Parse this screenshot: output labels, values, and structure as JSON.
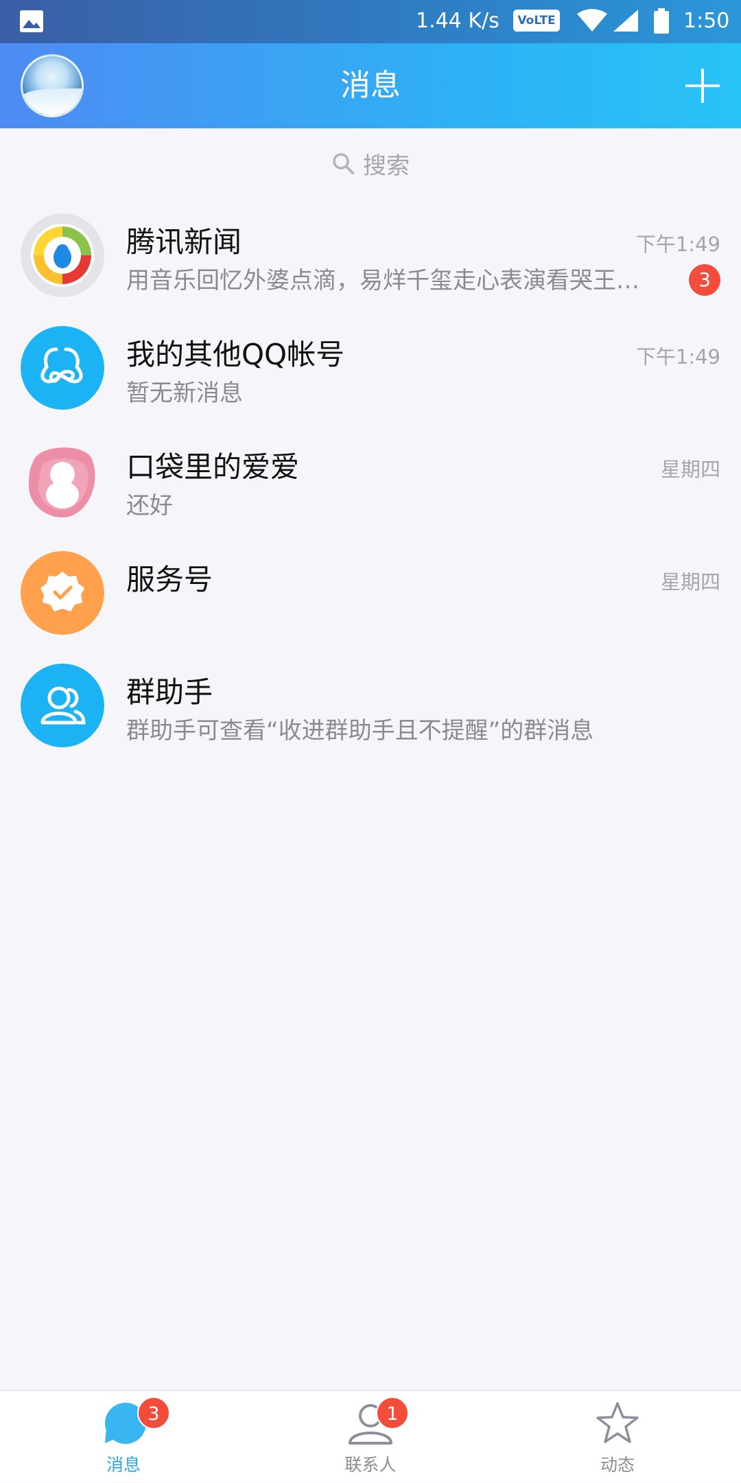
{
  "status_bar": {
    "network_speed": "1.44 K/s",
    "volte": "VoLTE",
    "time": "1:50"
  },
  "header": {
    "title": "消息"
  },
  "search": {
    "placeholder": "搜索"
  },
  "conversations": [
    {
      "name": "腾讯新闻",
      "message": "用音乐回忆外婆点滴，易烊千玺走心表演看哭王…",
      "time": "下午1:49",
      "unread": "3"
    },
    {
      "name": "我的其他QQ帐号",
      "message": "暂无新消息",
      "time": "下午1:49"
    },
    {
      "name": "口袋里的爱爱",
      "message": "还好",
      "time": "星期四"
    },
    {
      "name": "服务号",
      "message": "",
      "time": "星期四"
    },
    {
      "name": "群助手",
      "message": "群助手可查看“收进群助手且不提醒”的群消息",
      "time": ""
    }
  ],
  "tabbar": {
    "tabs": [
      {
        "label": "消息",
        "badge": "3",
        "active": true
      },
      {
        "label": "联系人",
        "badge": "1"
      },
      {
        "label": "动态"
      }
    ]
  },
  "colors": {
    "accent": "#2aa7e8",
    "badge": "#f24c3b"
  }
}
